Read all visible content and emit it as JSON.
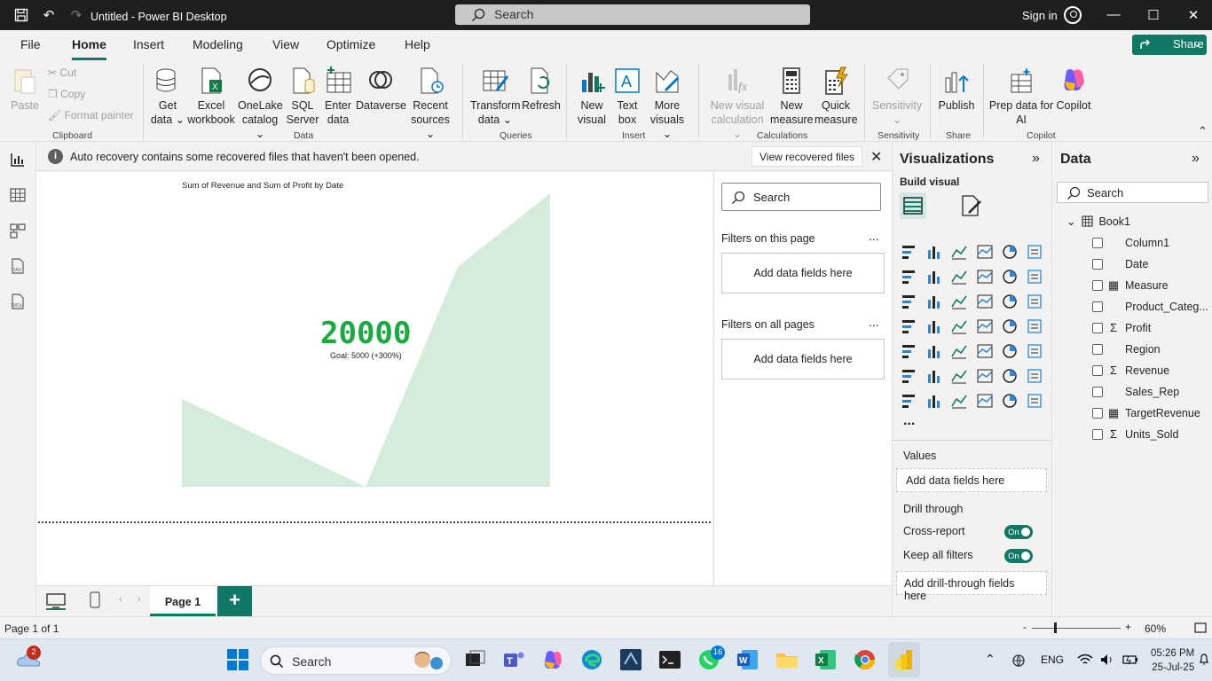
{
  "window": {
    "title": "Untitled - Power BI Desktop",
    "search_placeholder": "Search",
    "sign_in": "Sign in"
  },
  "menu": {
    "tabs": [
      "File",
      "Home",
      "Insert",
      "Modeling",
      "View",
      "Optimize",
      "Help"
    ],
    "active_tab": "Home",
    "share": "Share"
  },
  "ribbon": {
    "clipboard": {
      "paste": "Paste",
      "cut": "Cut",
      "copy": "Copy",
      "format_painter": "Format painter",
      "group": "Clipboard"
    },
    "data": {
      "get_data": [
        "Get",
        "data"
      ],
      "excel": [
        "Excel",
        "workbook"
      ],
      "onelake": [
        "OneLake",
        "catalog"
      ],
      "sql": [
        "SQL",
        "Server"
      ],
      "enter": [
        "Enter",
        "data"
      ],
      "dataverse": "Dataverse",
      "recent": [
        "Recent",
        "sources"
      ],
      "group": "Data"
    },
    "queries": {
      "transform": [
        "Transform",
        "data"
      ],
      "refresh": "Refresh",
      "group": "Queries"
    },
    "insert": {
      "new_visual": [
        "New",
        "visual"
      ],
      "text_box": [
        "Text",
        "box"
      ],
      "more_visuals": [
        "More",
        "visuals"
      ],
      "group": "Insert"
    },
    "calculations": {
      "new_visual_calc": [
        "New visual",
        "calculation"
      ],
      "new_measure": [
        "New",
        "measure"
      ],
      "quick_measure": [
        "Quick",
        "measure"
      ],
      "group": "Calculations"
    },
    "sensitivity": {
      "label": "Sensitivity",
      "group": "Sensitivity"
    },
    "share": {
      "publish": "Publish",
      "group": "Share"
    },
    "copilot": {
      "prep": [
        "Prep data for",
        "AI"
      ],
      "copilot": "Copilot",
      "group": "Copilot"
    }
  },
  "infobar": {
    "message": "Auto recovery contains some recovered files that haven't been opened.",
    "button": "View recovered files"
  },
  "canvas": {
    "chart_title": "Sum of Revenue and Sum of Profit by Date",
    "kpi_value": "20000",
    "kpi_goal": "Goal: 5000 (+300%)"
  },
  "filters": {
    "search": "Search",
    "on_page": "Filters on this page",
    "on_all": "Filters on all pages",
    "add": "Add data fields here",
    "more": "..."
  },
  "pages": {
    "tab": "Page 1",
    "add": "+"
  },
  "visualizations": {
    "title": "Visualizations",
    "build_visual": "Build visual",
    "more": "...",
    "values": "Values",
    "values_add": "Add data fields here",
    "drill_through": "Drill through",
    "cross_report": "Cross-report",
    "keep_filters": "Keep all filters",
    "toggle_on": "On",
    "drill_add": "Add drill-through fields here"
  },
  "data_pane": {
    "title": "Data",
    "search": "Search",
    "table": "Book1",
    "fields": [
      {
        "name": "Column1",
        "icon": ""
      },
      {
        "name": "Date",
        "icon": ""
      },
      {
        "name": "Measure",
        "icon": "calc"
      },
      {
        "name": "Product_Categ...",
        "icon": ""
      },
      {
        "name": "Profit",
        "icon": "sum"
      },
      {
        "name": "Region",
        "icon": ""
      },
      {
        "name": "Revenue",
        "icon": "sum"
      },
      {
        "name": "Sales_Rep",
        "icon": ""
      },
      {
        "name": "TargetRevenue",
        "icon": "calc"
      },
      {
        "name": "Units_Sold",
        "icon": "sum"
      }
    ]
  },
  "status": {
    "page": "Page 1 of 1",
    "zoom": "60%",
    "minus": "-",
    "plus": "+"
  },
  "taskbar": {
    "search": "Search",
    "lang": "ENG",
    "time": "05:26 PM",
    "date": "25-Jul-25",
    "weather_badge": "2",
    "whatsapp_badge": "16"
  },
  "colors": {
    "accent": "#117865",
    "area": "#d4ecd9",
    "kpi": "#1aab40"
  },
  "chart_data": {
    "type": "area",
    "title": "Sum of Revenue and Sum of Profit by Date",
    "x": [
      0,
      1,
      2,
      3,
      4
    ],
    "values": [
      6000,
      0,
      9000,
      15000,
      20000
    ]
  }
}
